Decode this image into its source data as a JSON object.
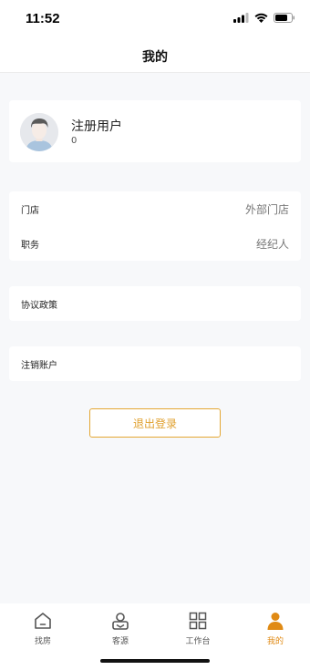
{
  "status": {
    "time": "11:52"
  },
  "nav": {
    "title": "我的"
  },
  "profile": {
    "name": "注册用户",
    "sub": "0"
  },
  "info": [
    {
      "label": "门店",
      "value": "外部门店"
    },
    {
      "label": "职务",
      "value": "经纪人"
    }
  ],
  "menu": {
    "agreement": "协议政策",
    "cancel_account": "注销账户"
  },
  "logout": {
    "label": "退出登录"
  },
  "tabs": [
    {
      "label": "找房",
      "icon": "home-icon"
    },
    {
      "label": "客源",
      "icon": "client-icon"
    },
    {
      "label": "工作台",
      "icon": "grid-icon"
    },
    {
      "label": "我的",
      "icon": "person-icon",
      "active": true
    }
  ],
  "colors": {
    "accent": "#e0a02e",
    "tab_active": "#e08a14"
  }
}
